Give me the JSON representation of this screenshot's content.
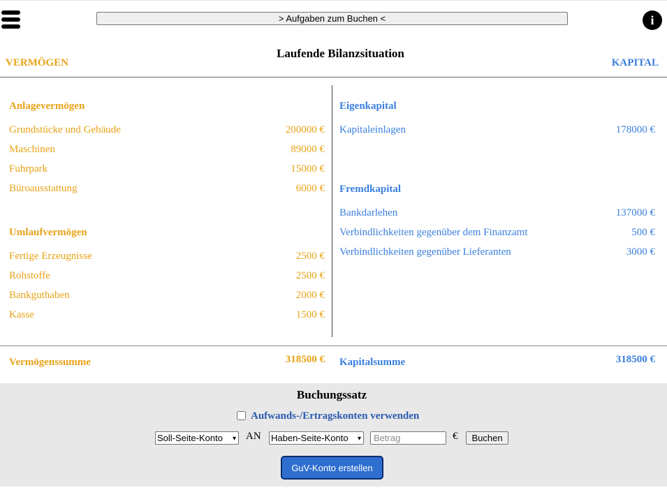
{
  "header": {
    "tasks_button": "> Aufgaben zum Buchen <",
    "info_icon": "i",
    "title": "Laufende Bilanzsituation",
    "left_heading": "VERMÖGEN",
    "right_heading": "KAPITAL"
  },
  "assets": {
    "anlage_title": "Anlagevermögen",
    "anlage_items": [
      {
        "label": "Grundstücke und Gebäude",
        "value": "200000 €"
      },
      {
        "label": "Maschinen",
        "value": "89000 €"
      },
      {
        "label": "Fuhrpark",
        "value": "15000 €"
      },
      {
        "label": "Büroausstattung",
        "value": "6000 €"
      }
    ],
    "umlauf_title": "Umlaufvermögen",
    "umlauf_items": [
      {
        "label": "Fertige Erzeugnisse",
        "value": "2500 €"
      },
      {
        "label": "Rohstoffe",
        "value": "2500 €"
      },
      {
        "label": "Bankguthaben",
        "value": "2000 €"
      },
      {
        "label": "Kasse",
        "value": "1500 €"
      }
    ],
    "sum_label": "Vermögenssumme",
    "sum_value": "318500 €"
  },
  "liabilities": {
    "eigen_title": "Eigenkapital",
    "eigen_items": [
      {
        "label": "Kapitaleinlagen",
        "value": "178000 €"
      }
    ],
    "fremd_title": "Fremdkapital",
    "fremd_items": [
      {
        "label": "Bankdarlehen",
        "value": "137000 €"
      },
      {
        "label": "Verbindlichkeiten gegenüber dem Finanzamt",
        "value": "500 €"
      },
      {
        "label": "Verbindlichkeiten gegenüber Lieferanten",
        "value": "3000 €"
      }
    ],
    "sum_label": "Kapitalsumme",
    "sum_value": "318500 €"
  },
  "booking": {
    "title": "Buchungssatz",
    "checkbox_label": "Aufwands-/Ertragskonten verwenden",
    "checkbox_checked": false,
    "debit_select": "Soll-Seite-Konto",
    "an_label": "AN",
    "credit_select": "Haben-Seite-Konto",
    "amount_placeholder": "Betrag",
    "currency": "€",
    "book_button": "Buchen",
    "guv_button": "GuV-Konto erstellen"
  },
  "colors": {
    "assets": "#e8a317",
    "liabilities": "#3a7fdc",
    "panel_bg": "#e8e8e8",
    "primary_button": "#2f6fd0"
  },
  "icons": [
    "hamburger-menu-icon",
    "info-icon",
    "chevron-down-icon"
  ]
}
